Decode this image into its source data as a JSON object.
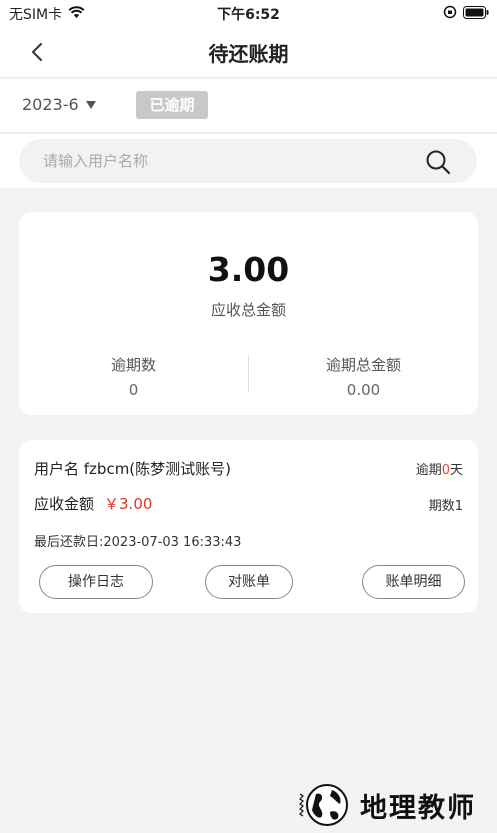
{
  "status_bar": {
    "carrier": "无SIM卡",
    "time": "下午6:52"
  },
  "nav": {
    "title": "待还账期",
    "back_icon": "chevron-left-icon"
  },
  "filter": {
    "month": "2023-6",
    "badge": "已逾期"
  },
  "search": {
    "placeholder": "请输入用户名称",
    "value": "",
    "icon": "search-icon"
  },
  "summary": {
    "total_amount": "3.00",
    "total_label": "应收总金额",
    "overdue_count_label": "逾期数",
    "overdue_count_value": "0",
    "overdue_amount_label": "逾期总金额",
    "overdue_amount_value": "0.00"
  },
  "records": [
    {
      "user": "用户名 fzbcm(陈梦测试账号)",
      "overdue_prefix": "逾期",
      "overdue_days": "0",
      "overdue_suffix": "天",
      "amount_label": "应收金额",
      "amount": "￥3.00",
      "periods": "期数1",
      "last_payment": "最后还款日:2023-07-03 16:33:43",
      "buttons": {
        "log": "操作日志",
        "reconcile": "对账单",
        "detail": "账单明细"
      }
    }
  ],
  "watermark": {
    "text": "地理教师"
  },
  "colors": {
    "accent_red": "#d9392f",
    "badge_gray": "#c8c8c8",
    "background": "#f3f3f3"
  }
}
